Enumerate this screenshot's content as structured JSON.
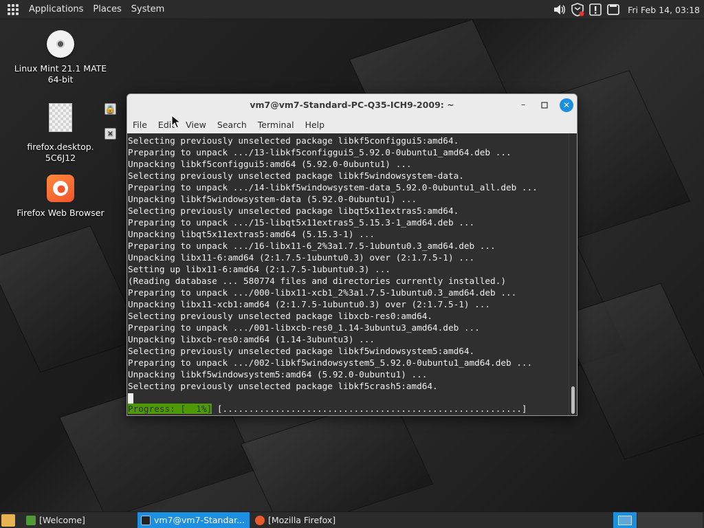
{
  "top_panel": {
    "menus": [
      "Applications",
      "Places",
      "System"
    ],
    "clock": "Fri Feb 14, 03:18",
    "tray_icons": [
      "volume-icon",
      "shield-icon",
      "update-manager-icon",
      "network-icon"
    ]
  },
  "desktop_icons": [
    {
      "label_line1": "Linux Mint 21.1 MATE",
      "label_line2": "64-bit",
      "icon": "dvd-icon"
    },
    {
      "label_line1": "firefox.desktop.",
      "label_line2": "5C6J12",
      "icon": "file-icon"
    },
    {
      "label_line1": "Firefox Web Browser",
      "label_line2": "",
      "icon": "firefox-icon"
    }
  ],
  "terminal": {
    "title": "vm7@vm7-Standard-PC-Q35-ICH9-2009: ~",
    "menu": [
      "File",
      "Edit",
      "View",
      "Search",
      "Terminal",
      "Help"
    ],
    "lines": [
      "Selecting previously unselected package libkf5configgui5:amd64.",
      "Preparing to unpack .../13-libkf5configgui5_5.92.0-0ubuntu1_amd64.deb ...",
      "Unpacking libkf5configgui5:amd64 (5.92.0-0ubuntu1) ...",
      "Selecting previously unselected package libkf5windowsystem-data.",
      "Preparing to unpack .../14-libkf5windowsystem-data_5.92.0-0ubuntu1_all.deb ...",
      "Unpacking libkf5windowsystem-data (5.92.0-0ubuntu1) ...",
      "Selecting previously unselected package libqt5x11extras5:amd64.",
      "Preparing to unpack .../15-libqt5x11extras5_5.15.3-1_amd64.deb ...",
      "Unpacking libqt5x11extras5:amd64 (5.15.3-1) ...",
      "Preparing to unpack .../16-libx11-6_2%3a1.7.5-1ubuntu0.3_amd64.deb ...",
      "Unpacking libx11-6:amd64 (2:1.7.5-1ubuntu0.3) over (2:1.7.5-1) ...",
      "Setting up libx11-6:amd64 (2:1.7.5-1ubuntu0.3) ...",
      "(Reading database ... 580774 files and directories currently installed.)",
      "Preparing to unpack .../000-libx11-xcb1_2%3a1.7.5-1ubuntu0.3_amd64.deb ...",
      "Unpacking libx11-xcb1:amd64 (2:1.7.5-1ubuntu0.3) over (2:1.7.5-1) ...",
      "Selecting previously unselected package libxcb-res0:amd64.",
      "Preparing to unpack .../001-libxcb-res0_1.14-3ubuntu3_amd64.deb ...",
      "Unpacking libxcb-res0:amd64 (1.14-3ubuntu3) ...",
      "Selecting previously unselected package libkf5windowsystem5:amd64.",
      "Preparing to unpack .../002-libkf5windowsystem5_5.92.0-0ubuntu1_amd64.deb ...",
      "Unpacking libkf5windowsystem5:amd64 (5.92.0-0ubuntu1) ...",
      "Selecting previously unselected package libkf5crash5:amd64."
    ],
    "progress_label": "Progress: [  1%]",
    "progress_bar": " [.........................................................]",
    "progress_percent": 1
  },
  "taskbar": {
    "tasks": [
      {
        "label": "[Welcome]",
        "active": false,
        "icon": "mint-welcome-icon"
      },
      {
        "label": "vm7@vm7-Standar...",
        "active": true,
        "icon": "terminal-icon"
      },
      {
        "label": "[Mozilla Firefox]",
        "active": false,
        "icon": "firefox-icon"
      }
    ]
  },
  "colors": {
    "accent": "#1c8fe0",
    "progress_green": "#4e9a06",
    "terminal_bg": "#2f2f2f",
    "panel_bg": "#2b2b2b"
  }
}
